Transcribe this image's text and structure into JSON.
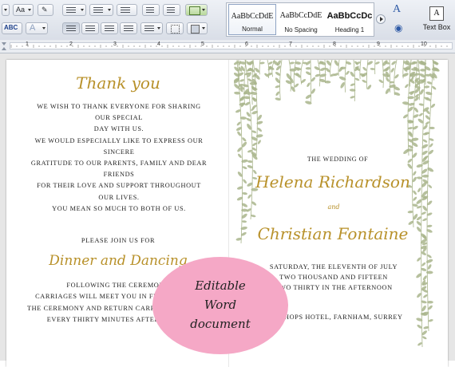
{
  "ribbon": {
    "font_size_label": "Aa",
    "styles": [
      {
        "sample": "AaBbCcDdE",
        "name": "Normal"
      },
      {
        "sample": "AaBbCcDdE",
        "name": "No Spacing"
      },
      {
        "sample": "AaBbCcDc",
        "name": "Heading 1"
      }
    ],
    "text_box_label": "Text Box",
    "change_styles_label": "A",
    "text_box_glyph": "A"
  },
  "ruler": {
    "numbers": [
      "1",
      "2",
      "3",
      "4",
      "5",
      "6",
      "7",
      "8",
      "9",
      "10"
    ]
  },
  "document": {
    "thank_you_title": "Thank you",
    "thank_you_lines": [
      "We wish to thank everyone for sharing our special",
      "day with us.",
      "We would especially like to express our sincere",
      "gratitude to our parents, family and dear friends",
      "for their love and support throughout our lives.",
      "You mean so much to both of us."
    ],
    "join_label": "Please join us for",
    "dinner_title": "Dinner and Dancing",
    "carriage_lines": [
      "Following the ceremony",
      "Carriages will meet you in front of the",
      "the ceremony and return carriages will be",
      "every thirty minutes after dinner"
    ],
    "wedding_of": "The Wedding of",
    "name1": "Helena Richardson",
    "and": "and",
    "name2": "Christian Fontaine",
    "date_lines": [
      "Saturday, the eleventh of July",
      "two thousand and fifteen",
      "two thirty in the afternoon"
    ],
    "venue": "Bishops Hotel, Farnham, Surrey"
  },
  "badge": {
    "lines": [
      "Editable",
      "Word",
      "document"
    ],
    "color": "#f5a8c6"
  },
  "colors": {
    "accent_gold": "#b8912a",
    "vine_green": "#a9b58c"
  }
}
